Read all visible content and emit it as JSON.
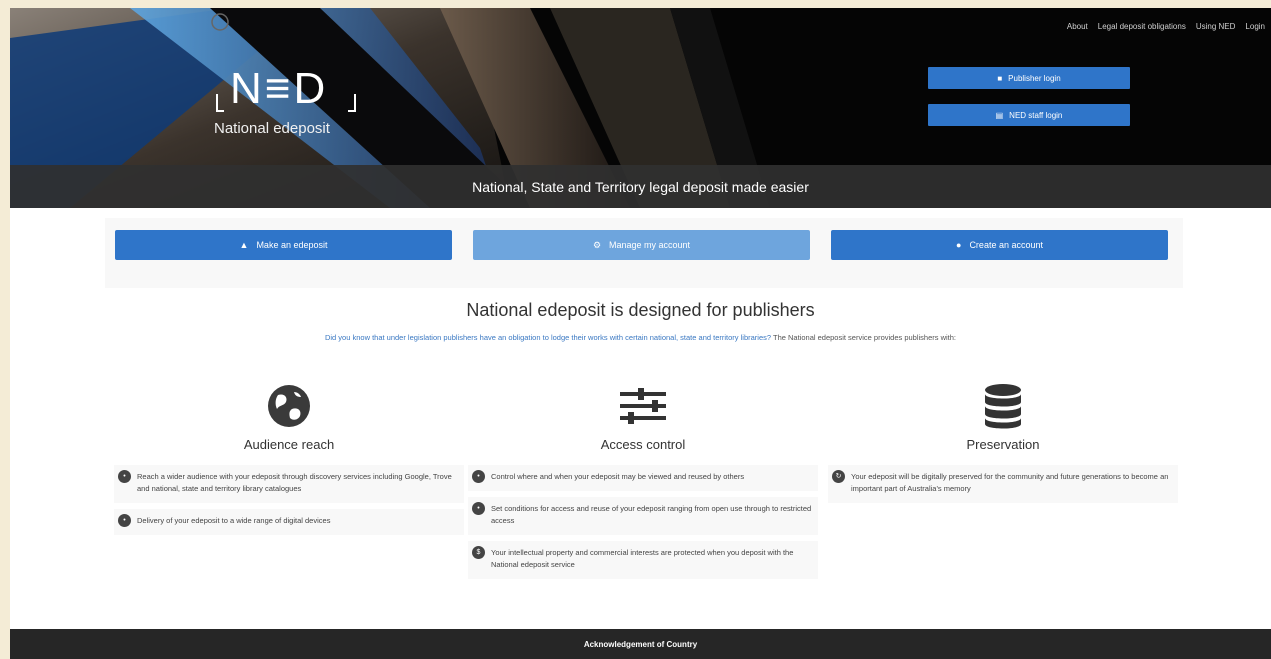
{
  "topnav": [
    "About",
    "Legal deposit obligations",
    "Using NED",
    "Login"
  ],
  "logo": {
    "mark": "N≡D",
    "subtitle": "National edeposit"
  },
  "hero": {
    "publisher_login": "Publisher login",
    "staff_login": "NED staff login",
    "tagline": "National, State and Territory legal deposit made easier"
  },
  "actions": {
    "make": "Make an edeposit",
    "manage": "Manage my account",
    "create": "Create an account"
  },
  "intro": {
    "title": "National edeposit is designed for publishers",
    "link_text": "Did you know that under legislation publishers have an obligation to lodge their works with certain national, state and territory libraries?",
    "rest_text": " The National edeposit service provides publishers with:"
  },
  "features": [
    {
      "icon": "globe-icon",
      "title": "Audience reach",
      "items": [
        "Reach a wider audience with your edeposit through discovery services including Google, Trove and national, state and territory library catalogues",
        "Delivery of your edeposit to a wide range of digital devices"
      ]
    },
    {
      "icon": "sliders-icon",
      "title": "Access control",
      "items": [
        "Control where and when your edeposit may be viewed and reused by others",
        "Set conditions for access and reuse of your edeposit ranging from open use through to restricted access",
        "Your intellectual property and commercial interests are protected when you deposit with the National edeposit service"
      ]
    },
    {
      "icon": "database-icon",
      "title": "Preservation",
      "items": [
        "Your edeposit will be digitally preserved for the community and future generations to become an important part of Australia's memory"
      ]
    }
  ],
  "footer": {
    "label": "Acknowledgement of Country"
  },
  "colors": {
    "primary": "#2f75c9",
    "primary_light": "#6ea5dd",
    "footer_bg": "#262626"
  }
}
